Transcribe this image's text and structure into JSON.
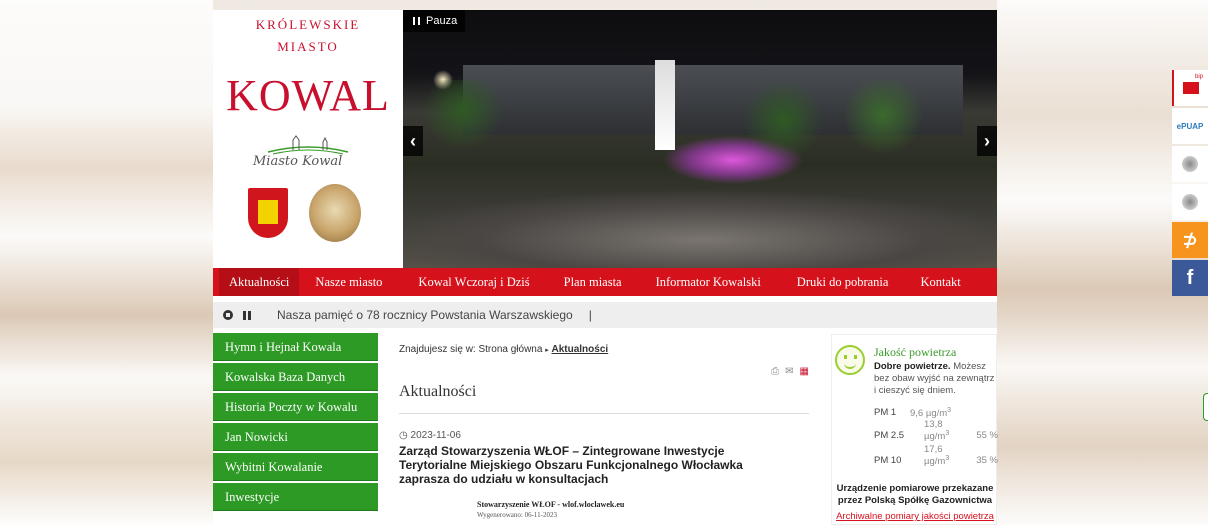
{
  "header": {
    "royal_line1": "KRÓLEWSKIE",
    "royal_line2": "MIASTO",
    "city_name": "KOWAL",
    "logo_script": "Miasto Kowal"
  },
  "slider": {
    "pause_label": "Pauza",
    "prev_icon": "chevron-left-icon",
    "next_icon": "chevron-right-icon",
    "prev_glyph": "‹",
    "next_glyph": "›"
  },
  "nav": {
    "items": [
      {
        "label": "Aktualności",
        "active": true
      },
      {
        "label": "Nasze miasto"
      },
      {
        "label": "Kowal Wczoraj i Dziś"
      },
      {
        "label": "Plan miasta"
      },
      {
        "label": "Informator Kowalski"
      },
      {
        "label": "Druki do pobrania"
      },
      {
        "label": "Kontakt"
      }
    ]
  },
  "ticker": {
    "text": "Nasza pamięć o 78 rocznicy Powstania Warszawskiego",
    "separator": "|"
  },
  "sidemenu": {
    "items": [
      {
        "label": "Hymn i Hejnał Kowala"
      },
      {
        "label": "Kowalska Baza Danych"
      },
      {
        "label": "Historia Poczty w Kowalu"
      },
      {
        "label": "Jan Nowicki"
      },
      {
        "label": "Wybitni Kowalanie"
      },
      {
        "label": "Inwestycje"
      }
    ]
  },
  "main": {
    "breadcrumb_prefix": "Znajdujesz się w: Strona główna",
    "breadcrumb_current": "Aktualności",
    "breadcrumb_sep": "▸",
    "page_title": "Aktualności",
    "article": {
      "date": "2023-11-06",
      "title": "Zarząd Stowarzyszenia WŁOF – Zintegrowane Inwestycje Terytorialne Miejskiego Obszaru Funkcjonalnego Włocławka zaprasza do udziału w konsultacjach",
      "thumb_line1": "Stowarzyszenie WŁOF - wlof.wloclawek.eu",
      "thumb_line2": "Wygenerowano: 06-11-2023"
    }
  },
  "air_quality": {
    "title": "Jakość powietrza",
    "status": "Dobre powietrze.",
    "advice": "Możesz bez obaw wyjść na zewnątrz i cieszyć się dniem.",
    "unit": "µg/m",
    "unit_sup": "3",
    "readings": [
      {
        "name": "PM 1",
        "value": "9,6",
        "sub": "",
        "percent": ""
      },
      {
        "name": "PM 2.5",
        "value": "",
        "sub": "13,8",
        "percent": "55 %"
      },
      {
        "name": "PM 10",
        "value": "",
        "sub": "17,6",
        "percent": "35 %"
      }
    ],
    "device_line1": "Urządzenie pomiarowe przekazane",
    "device_line2": "przez Polską Spółkę Gazownictwa",
    "archive_link": "Archiwalne pomiary jakości powietrza"
  },
  "side_buttons": {
    "epuap": "ePUAP",
    "rss": "RSS",
    "facebook": "f"
  }
}
